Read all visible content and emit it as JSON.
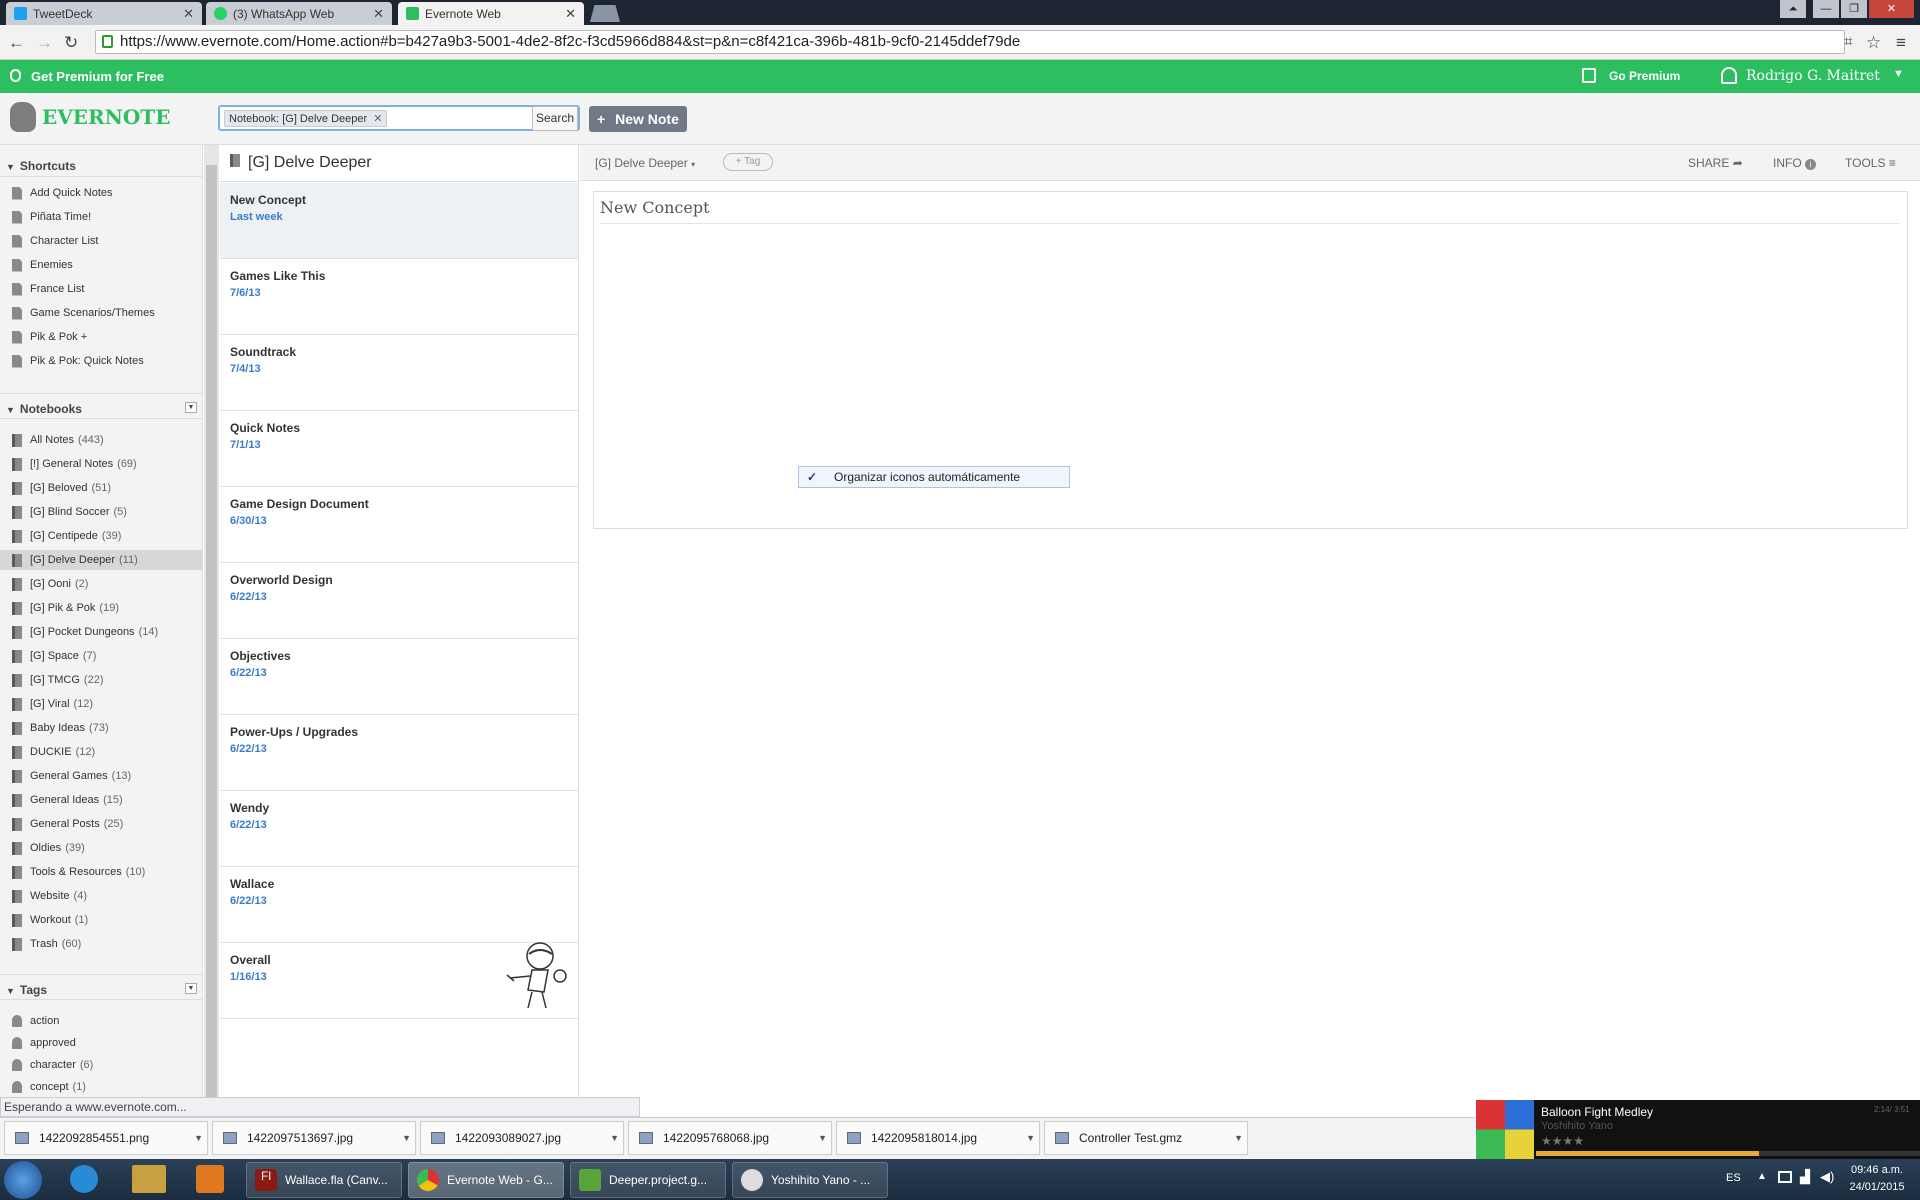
{
  "browser": {
    "tabs": [
      {
        "label": "TweetDeck",
        "color": "#1da1f2"
      },
      {
        "label": "(3) WhatsApp Web",
        "color": "#25d366"
      },
      {
        "label": "Evernote Web",
        "color": "#2dbe60"
      }
    ],
    "url": "https://www.evernote.com/Home.action#b=b427a9b3-5001-4de2-8f2c-f3cd5966d884&st=p&n=c8f421ca-396b-481b-9cf0-2145ddef79de"
  },
  "promo": {
    "get_premium": "Get Premium for Free",
    "go_premium": "Go Premium",
    "user": "Rodrigo G. Maitret",
    "accent": "#2dbe60"
  },
  "header": {
    "logo": "EVERNOTE",
    "search_chip": "Notebook: [G] Delve Deeper",
    "search_button": "Search",
    "new_note": "New Note"
  },
  "sidebar": {
    "shortcuts_title": "Shortcuts",
    "shortcuts": [
      "Add Quick Notes",
      "Piñata Time!",
      "Character List",
      "Enemies",
      "France List",
      "Game Scenarios/Themes",
      "Pik & Pok +",
      "Pik & Pok: Quick Notes"
    ],
    "notebooks_title": "Notebooks",
    "notebooks": [
      {
        "name": "All Notes",
        "count": "(443)"
      },
      {
        "name": "[!] General Notes",
        "count": "(69)"
      },
      {
        "name": "[G] Beloved",
        "count": "(51)"
      },
      {
        "name": "[G] Blind Soccer",
        "count": "(5)"
      },
      {
        "name": "[G] Centipede",
        "count": "(39)"
      },
      {
        "name": "[G] Delve Deeper",
        "count": "(11)",
        "selected": true
      },
      {
        "name": "[G] Ooni",
        "count": "(2)"
      },
      {
        "name": "[G] Pik & Pok",
        "count": "(19)"
      },
      {
        "name": "[G] Pocket Dungeons",
        "count": "(14)"
      },
      {
        "name": "[G] Space",
        "count": "(7)"
      },
      {
        "name": "[G] TMCG",
        "count": "(22)"
      },
      {
        "name": "[G] Viral",
        "count": "(12)"
      },
      {
        "name": "Baby Ideas",
        "count": "(73)"
      },
      {
        "name": "DUCKIE",
        "count": "(12)"
      },
      {
        "name": "General Games",
        "count": "(13)"
      },
      {
        "name": "General Ideas",
        "count": "(15)"
      },
      {
        "name": "General Posts",
        "count": "(25)"
      },
      {
        "name": "Oldies",
        "count": "(39)"
      },
      {
        "name": "Tools & Resources",
        "count": "(10)"
      },
      {
        "name": "Website",
        "count": "(4)"
      },
      {
        "name": "Workout",
        "count": "(1)"
      },
      {
        "name": "Trash",
        "count": "(60)"
      }
    ],
    "tags_title": "Tags",
    "tags": [
      {
        "name": "action",
        "count": ""
      },
      {
        "name": "approved",
        "count": ""
      },
      {
        "name": "character",
        "count": "(6)"
      },
      {
        "name": "concept",
        "count": "(1)"
      }
    ]
  },
  "notelist": {
    "title": "[G] Delve Deeper",
    "notes": [
      {
        "title": "New Concept",
        "date": "Last week"
      },
      {
        "title": "Games Like This",
        "date": "7/6/13"
      },
      {
        "title": "Soundtrack",
        "date": "7/4/13"
      },
      {
        "title": "Quick Notes",
        "date": "7/1/13"
      },
      {
        "title": "Game Design Document",
        "date": "6/30/13"
      },
      {
        "title": "Overworld Design",
        "date": "6/22/13"
      },
      {
        "title": "Objectives",
        "date": "6/22/13"
      },
      {
        "title": "Power-Ups / Upgrades",
        "date": "6/22/13"
      },
      {
        "title": "Wendy",
        "date": "6/22/13"
      },
      {
        "title": "Wallace",
        "date": "6/22/13"
      },
      {
        "title": "Overall",
        "date": "1/16/13"
      }
    ]
  },
  "editor": {
    "notebook": "[G] Delve Deeper",
    "tag_button": "+ Tag",
    "share": "SHARE",
    "info": "INFO",
    "tools": "TOOLS",
    "note_title": "New Concept"
  },
  "context_menu": {
    "item": "Organizar iconos automáticamente"
  },
  "status": "Esperando a www.evernote.com...",
  "downloads": [
    "1422092854551.png",
    "1422097513697.jpg",
    "1422093089027.jpg",
    "1422095768068.jpg",
    "1422095818014.jpg",
    "Controller Test.gmz"
  ],
  "player": {
    "track": "Balloon Fight Medley",
    "artist": "Yoshihito Yano",
    "time": "2:14/ 3:51",
    "stars": "★★★★"
  },
  "taskbar": {
    "items": [
      "Wallace.fla (Canv...",
      "Evernote Web - G...",
      "Deeper.project.g...",
      "Yoshihito Yano - ..."
    ],
    "lang": "ES",
    "time": "09:46 a.m.",
    "date": "24/01/2015"
  }
}
